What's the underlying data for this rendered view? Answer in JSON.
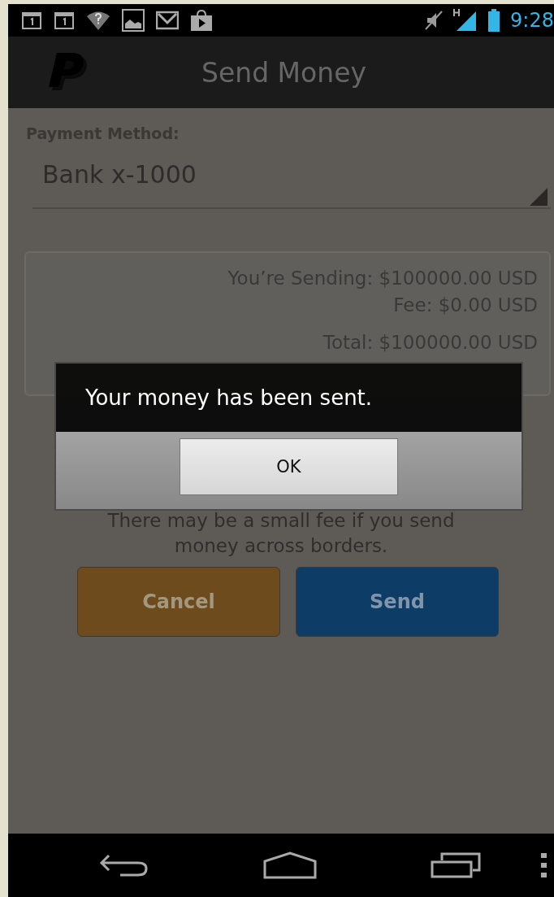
{
  "status_bar": {
    "time": "9:28"
  },
  "app_bar": {
    "title": "Send Money"
  },
  "payment_method": {
    "label": "Payment Method:",
    "value": "Bank x-1000"
  },
  "summary": {
    "lines": [
      "You’re Sending: $100000.00 USD",
      "Fee: $0.00 USD",
      "Total: $100000.00 USD"
    ]
  },
  "note": "There may be a small fee if you send money across borders.",
  "buttons": [
    {
      "label": "Cancel",
      "kind": "cancel"
    },
    {
      "label": "Send",
      "kind": "send"
    }
  ],
  "dialog": {
    "message": "Your money has been sent.",
    "button": "OK"
  }
}
